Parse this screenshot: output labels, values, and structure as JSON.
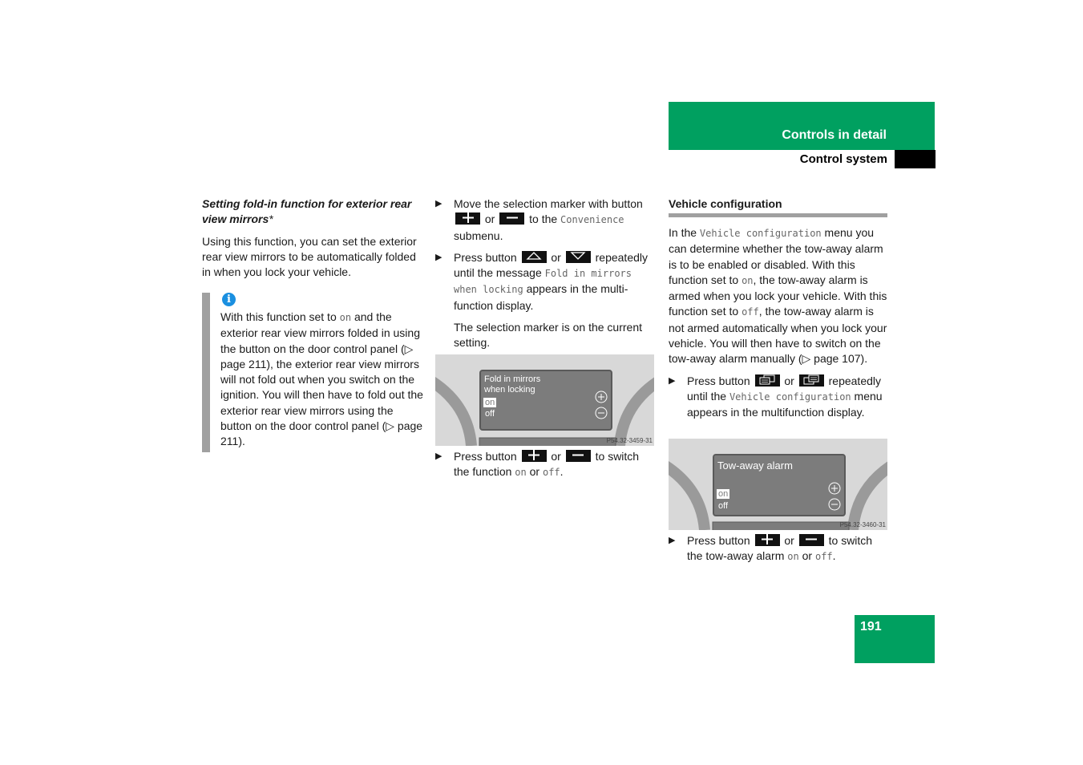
{
  "header": {
    "section_title": "Controls in detail",
    "subsection_title": "Control system",
    "accent_color": "#00a060"
  },
  "page_number": "191",
  "left_column": {
    "heading": "Setting fold-in function for exterior rear view mirrors",
    "heading_marker": "*",
    "intro": "Using this function, you can set the exterior rear view mirrors to be automatically folded in when you lock your vehicle.",
    "note": {
      "icon": "info-icon",
      "text_1": "With this function set to ",
      "code_on": "on",
      "text_2": " and the exterior rear view mirrors folded in using the button on the door control panel (▷ page 211), the exterior rear view mirrors will not fold out when you switch on the ignition. You will then have to fold out the exterior rear view mirrors using the button on the door control panel (▷ page 211)."
    }
  },
  "middle_column": {
    "step1": {
      "text_a": "Move the selection marker with button",
      "or": "or",
      "text_b": "to the",
      "code": "Convenience",
      "text_c": "submenu."
    },
    "step2": {
      "text_a": "Press button",
      "or": "or",
      "text_b": "repeatedly until the message",
      "code": "Fold in mirrors when locking",
      "text_c": "appears in the multi-function display."
    },
    "step2_result": "The selection marker is on the current setting.",
    "figure": {
      "line1": "Fold in mirrors",
      "line2": "when locking",
      "opt_on": "on",
      "opt_off": "off",
      "code": "P54.32-3459-31"
    },
    "step3": {
      "text_a": "Press button",
      "or": "or",
      "text_b": "to switch the function",
      "code_on": "on",
      "or2": "or",
      "code_off": "off",
      "end": "."
    }
  },
  "right_column": {
    "heading": "Vehicle configuration",
    "para": {
      "t1": "In the ",
      "c1": "Vehicle configuration",
      "t2": " menu you can determine whether the tow-away alarm is to be enabled or disabled. With this function set to ",
      "c2": "on",
      "t3": ", the tow-away alarm is armed when you lock your vehicle. With this function set to ",
      "c3": "off",
      "t4": ", the tow-away alarm is not armed automatically when you lock your vehicle. You will then have to switch on the tow-away alarm manually (▷ page 107)."
    },
    "step1": {
      "text_a": "Press button",
      "or": "or",
      "text_b": "repeatedly until the",
      "code": "Vehicle configuration",
      "text_c": "menu appears in the multifunction display."
    },
    "figure": {
      "title": "Tow-away alarm",
      "opt_on": "on",
      "opt_off": "off",
      "code": "P54.32-3460-31"
    },
    "step2": {
      "text_a": "Press button",
      "or": "or",
      "text_b": "to switch the tow-away alarm",
      "code_on": "on",
      "or2": "or",
      "code_off": "off",
      "end": "."
    }
  },
  "bullet": "▶"
}
